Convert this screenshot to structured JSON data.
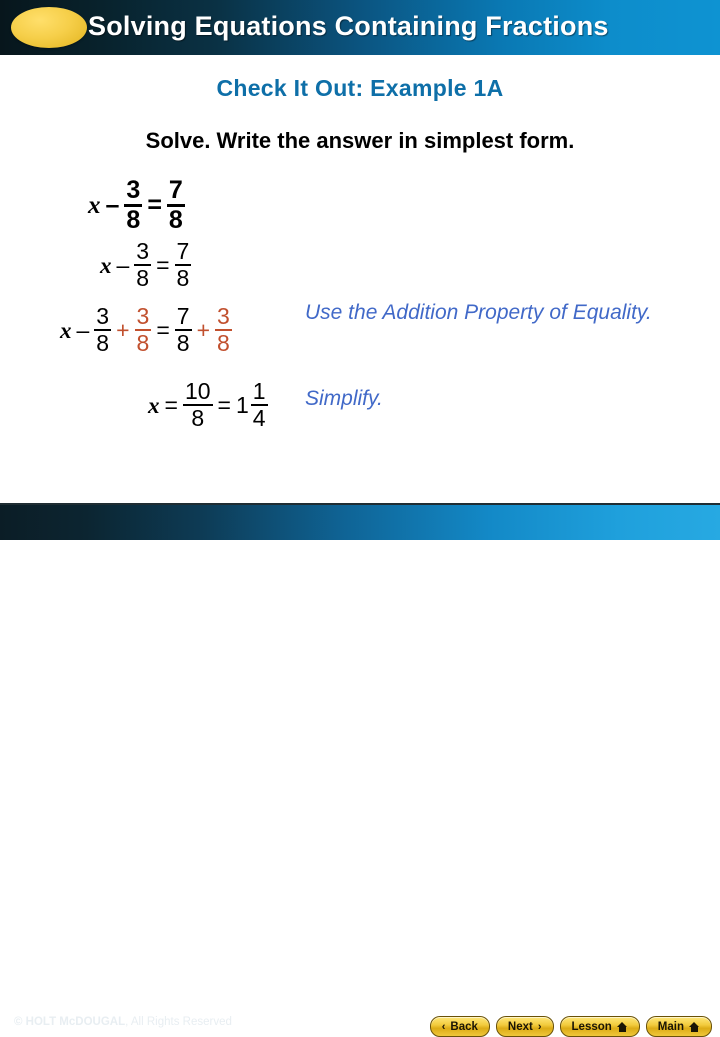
{
  "header": {
    "title": "Solving Equations Containing Fractions",
    "badge_icon": "yellow-ellipse-icon"
  },
  "subtitle": "Check It Out: Example 1A",
  "prompt": "Solve. Write the answer in simplest form.",
  "equations": [
    {
      "id": "original-equation",
      "tokens": [
        {
          "kind": "var",
          "text": "x"
        },
        {
          "kind": "op",
          "text": "–"
        },
        {
          "kind": "frac",
          "num": "3",
          "den": "8"
        },
        {
          "kind": "op",
          "text": "="
        },
        {
          "kind": "frac",
          "num": "7",
          "den": "8"
        }
      ]
    },
    {
      "id": "restated-equation",
      "tokens": [
        {
          "kind": "var",
          "text": "x"
        },
        {
          "kind": "op",
          "text": "–"
        },
        {
          "kind": "frac",
          "num": "3",
          "den": "8"
        },
        {
          "kind": "op",
          "text": "="
        },
        {
          "kind": "frac",
          "num": "7",
          "den": "8"
        }
      ]
    },
    {
      "id": "add-both-sides-equation",
      "tokens": [
        {
          "kind": "var",
          "text": "x"
        },
        {
          "kind": "op",
          "text": "–"
        },
        {
          "kind": "frac",
          "num": "3",
          "den": "8"
        },
        {
          "kind": "op",
          "text": "+",
          "color": "red"
        },
        {
          "kind": "frac",
          "num": "3",
          "den": "8",
          "color": "red"
        },
        {
          "kind": "op",
          "text": "="
        },
        {
          "kind": "frac",
          "num": "7",
          "den": "8"
        },
        {
          "kind": "op",
          "text": "+",
          "color": "red"
        },
        {
          "kind": "frac",
          "num": "3",
          "den": "8",
          "color": "red"
        }
      ]
    },
    {
      "id": "solution-equation",
      "tokens": [
        {
          "kind": "var",
          "text": "x"
        },
        {
          "kind": "op",
          "text": "="
        },
        {
          "kind": "frac",
          "num": "10",
          "den": "8"
        },
        {
          "kind": "op",
          "text": "="
        },
        {
          "kind": "mixed",
          "whole": "1",
          "num": "1",
          "den": "4"
        }
      ]
    }
  ],
  "annotations": [
    {
      "id": "addition-property-note",
      "text": "Use the Addition Property of Equality."
    },
    {
      "id": "simplify-note",
      "text": "Simplify."
    }
  ],
  "footer": {
    "copyright_brand": "© HOLT McDOUGAL",
    "copyright_rest": ", All Rights Reserved",
    "buttons": [
      {
        "label": "Back",
        "icon": "chevron-left-icon",
        "glyph": "‹",
        "icon_side": "left"
      },
      {
        "label": "Next",
        "icon": "chevron-right-icon",
        "glyph": "›",
        "icon_side": "right"
      },
      {
        "label": "Lesson",
        "icon": "home-icon",
        "icon_side": "right"
      },
      {
        "label": "Main",
        "icon": "home-icon",
        "icon_side": "right"
      }
    ]
  },
  "colors": {
    "header_dark": "#07161c",
    "header_blue": "#0e93d2",
    "subtitle_blue": "#0e6fa8",
    "annotation_blue": "#4169c8",
    "highlight_red": "#c1502e",
    "badge_yellow": "#f2cb3d",
    "page_background": "#ffffff"
  }
}
